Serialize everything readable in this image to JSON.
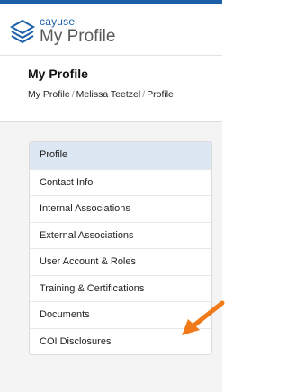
{
  "brand": {
    "name": "cayuse",
    "product": "My Profile"
  },
  "page": {
    "title": "My Profile"
  },
  "breadcrumb": [
    "My Profile",
    "Melissa Teetzel",
    "Profile"
  ],
  "menu": [
    {
      "label": "Profile",
      "active": true
    },
    {
      "label": "Contact Info"
    },
    {
      "label": "Internal Associations"
    },
    {
      "label": "External Associations"
    },
    {
      "label": "User Account & Roles"
    },
    {
      "label": "Training & Certifications"
    },
    {
      "label": "Documents"
    },
    {
      "label": "COI Disclosures"
    }
  ],
  "colors": {
    "brand": "#1a5fa8",
    "active_item": "#dde7f4",
    "annotation_arrow": "#f07a1a"
  },
  "annotation": {
    "icon": "arrow-pointer-icon",
    "target": "COI Disclosures"
  }
}
